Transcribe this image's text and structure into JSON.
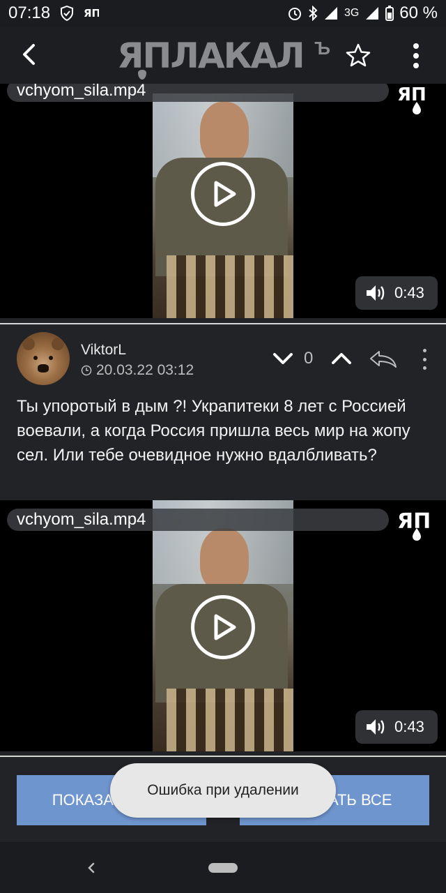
{
  "status_bar": {
    "time": "07:18",
    "network": "3G",
    "battery": "60 %",
    "icons": [
      "shield-icon",
      "yap-notification-icon",
      "alarm-icon",
      "bluetooth-icon",
      "signal-icon",
      "signal-icon",
      "battery-icon"
    ]
  },
  "app_bar": {
    "logo_text": "ЯПЛАКАЛ",
    "logo_sup": "Ъ",
    "icons": [
      "back-arrow-icon",
      "star-icon",
      "more-vertical-icon"
    ]
  },
  "video_top": {
    "filename": "vchyom_sila.mp4",
    "duration": "0:43",
    "badge": "ЯП"
  },
  "comment": {
    "username": "ViktorL",
    "timestamp": "20.03.22 03:12",
    "vote_count": "0",
    "text": "Ты упоротый в дым ?! Украпитеки 8 лет с Россией воевали, а когда Россия пришла весь мир на жопу сел. Или тебе очевидное нужно вдалбливать?"
  },
  "video_bottom": {
    "filename": "vchyom_sila.mp4",
    "duration": "0:43",
    "badge": "ЯП"
  },
  "buttons": {
    "show_more": "ПОКАЗАТЬ ЕЩЁ",
    "show_all": "ПОКАЗАТЬ ВСЕ"
  },
  "toast": {
    "message": "Ошибка при удалении"
  },
  "colors": {
    "accent_button": "#6f95cf",
    "background": "#222326",
    "toast_bg": "#e7e7e7"
  }
}
